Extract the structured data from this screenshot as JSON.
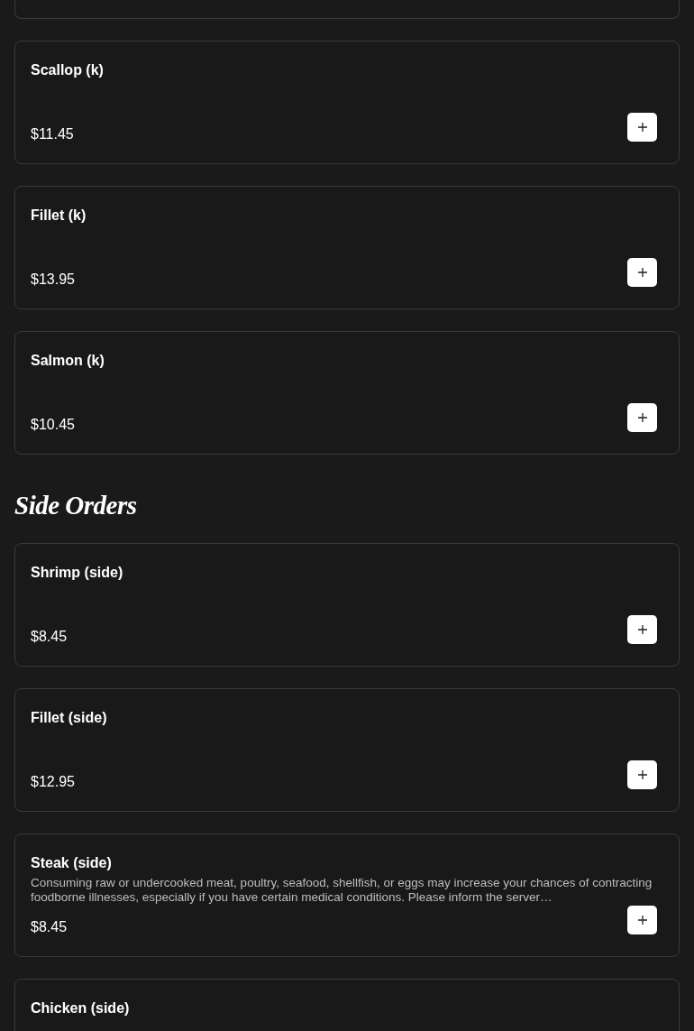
{
  "sections": [
    {
      "items": [
        {
          "kind": "partial"
        },
        {
          "name": "Scallop (k)",
          "price": "$11.45"
        },
        {
          "name": "Fillet (k)",
          "price": "$13.95"
        },
        {
          "name": "Salmon (k)",
          "price": "$10.45"
        }
      ]
    },
    {
      "heading": "Side Orders",
      "items": [
        {
          "name": "Shrimp (side)",
          "price": "$8.45"
        },
        {
          "name": "Fillet (side)",
          "price": "$12.95"
        },
        {
          "name": "Steak (side)",
          "description": "Consuming raw or undercooked meat, poultry, seafood, shellfish, or eggs may increase your chances of contracting foodborne illnesses, especially if you have certain medical conditions. Please inform the server…",
          "price": "$8.45"
        },
        {
          "name": "Chicken (side)"
        }
      ]
    }
  ]
}
